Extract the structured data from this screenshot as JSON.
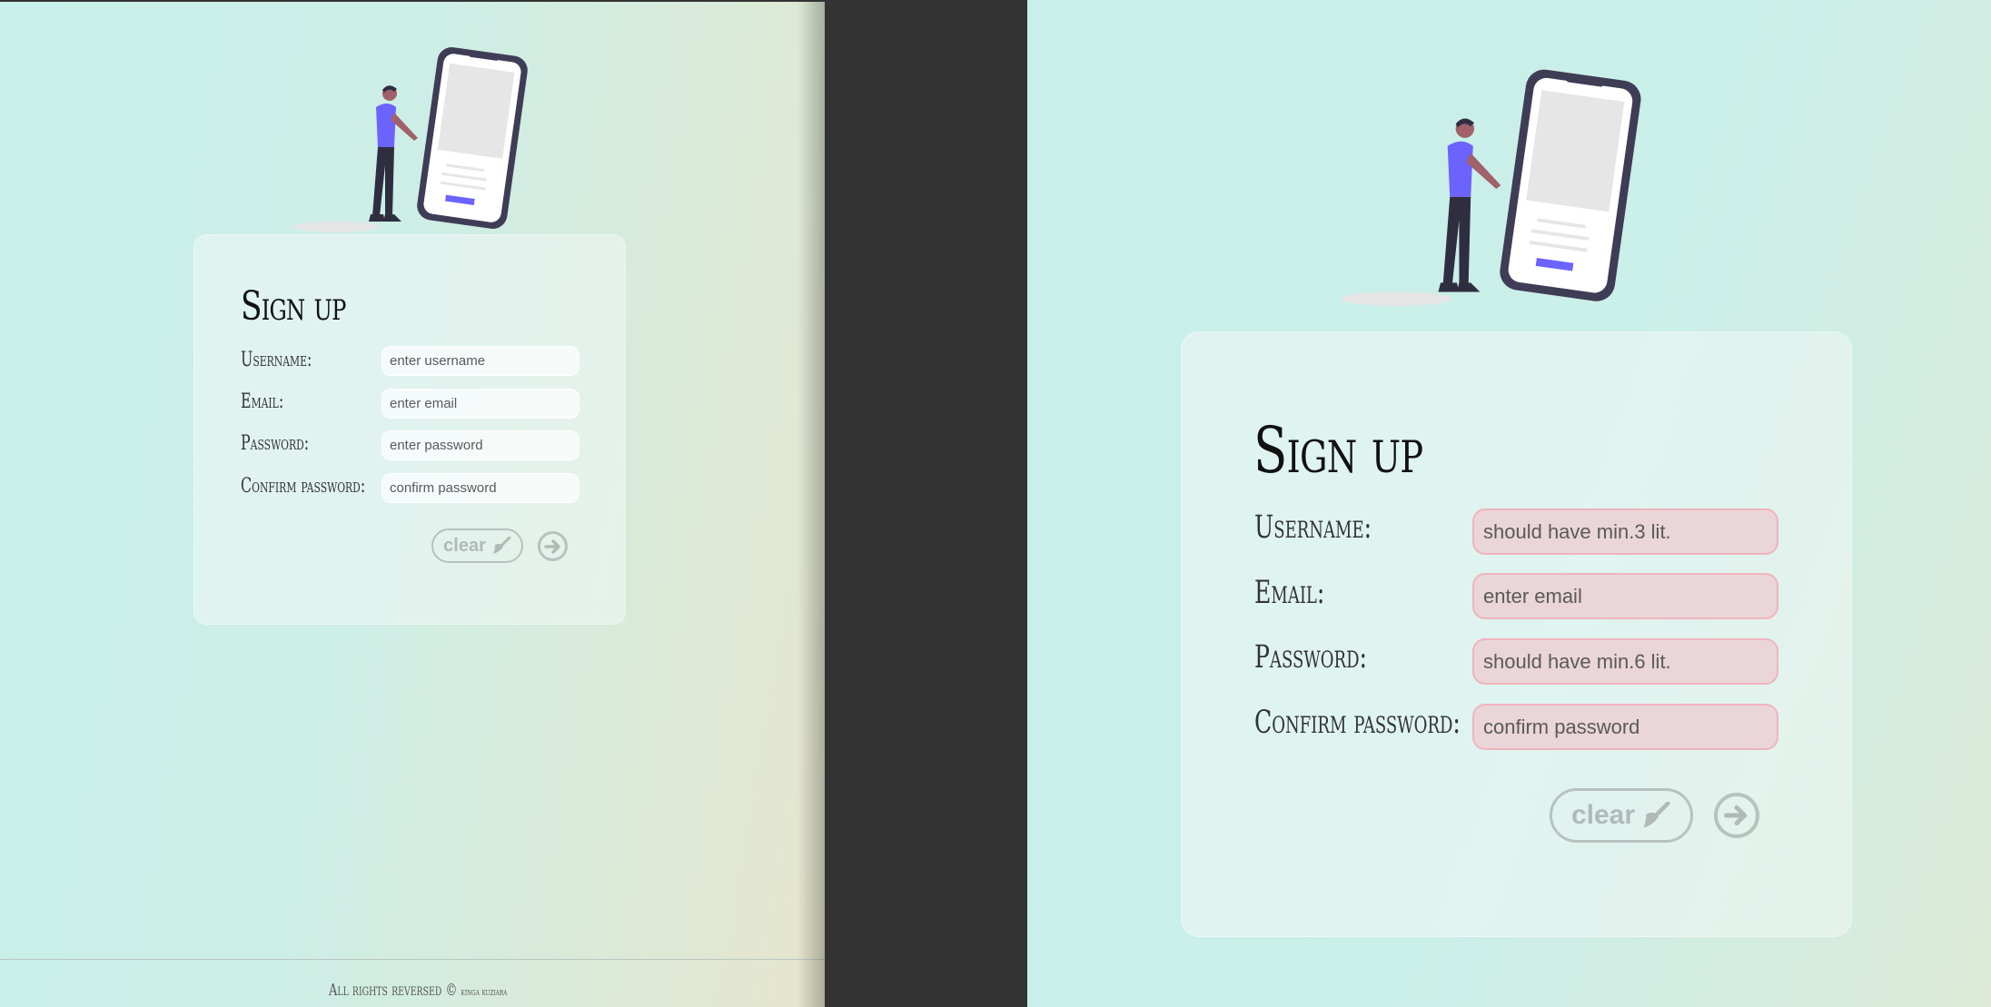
{
  "form": {
    "title": "Sign up",
    "labels": {
      "username": "Username:",
      "email": "Email:",
      "password": "Password:",
      "confirm": "Confirm password:"
    },
    "clear_label": "clear"
  },
  "left": {
    "placeholders": {
      "username": "enter username",
      "email": "enter email",
      "password": "enter password",
      "confirm": "confirm password"
    }
  },
  "right": {
    "placeholders": {
      "username": "should have min.3 lit.",
      "email": "enter email",
      "password": "should have min.6 lit.",
      "confirm": "confirm password"
    }
  },
  "footer": {
    "text": "All rights reversed ©",
    "author": "kinga kuziara"
  },
  "colors": {
    "accent": "#6c63ff",
    "error_border": "#f0b4be",
    "error_bg": "#ebd2d6"
  }
}
